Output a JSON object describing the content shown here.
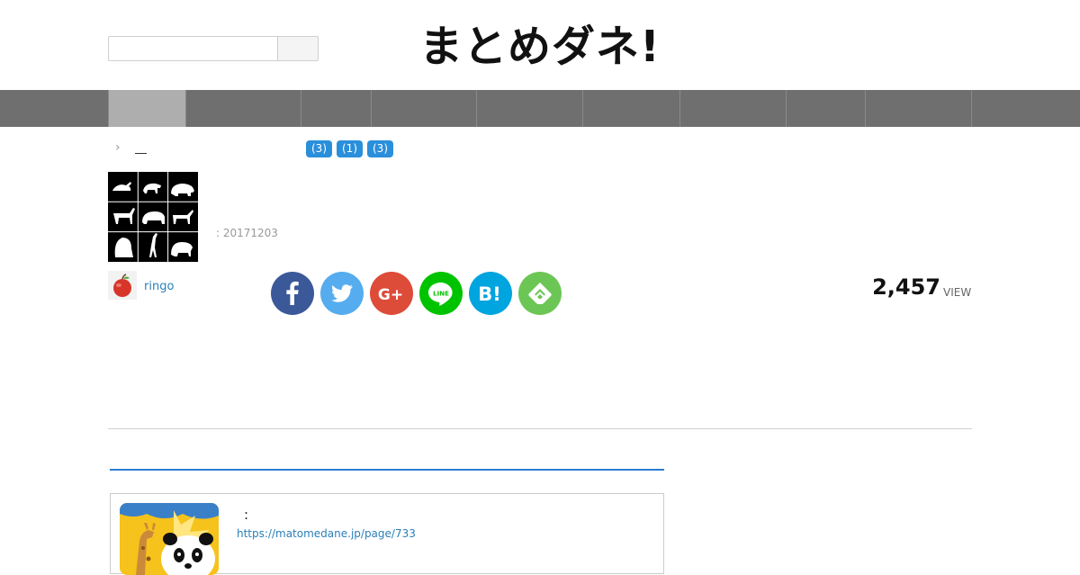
{
  "header": {
    "site_title": "まとめダネ!",
    "search_placeholder": "",
    "search_button_label": ""
  },
  "nav": {
    "items": [
      {
        "label": ""
      },
      {
        "label": ""
      },
      {
        "label": ""
      },
      {
        "label": ""
      },
      {
        "label": ""
      },
      {
        "label": ""
      },
      {
        "label": ""
      },
      {
        "label": ""
      },
      {
        "label": ""
      },
      {
        "label": ""
      }
    ]
  },
  "breadcrumb": {
    "chevron": "›"
  },
  "tags": [
    {
      "label": "(3)"
    },
    {
      "label": "(1)"
    },
    {
      "label": "(3)"
    }
  ],
  "article": {
    "date": ": 20171203",
    "author": "ringo",
    "view_count": "2,457",
    "view_label": "VIEW"
  },
  "share": [
    {
      "name": "facebook",
      "color": "#3b5998",
      "icon": "facebook-icon"
    },
    {
      "name": "twitter",
      "color": "#55acee",
      "icon": "twitter-icon"
    },
    {
      "name": "google-plus",
      "color": "#dd4b39",
      "icon": "google-plus-icon"
    },
    {
      "name": "line",
      "color": "#00c300",
      "icon": "line-icon"
    },
    {
      "name": "hatena",
      "color": "#00a4de",
      "icon": "hatena-bookmark-icon"
    },
    {
      "name": "feedly",
      "color": "#6cc655",
      "icon": "feedly-icon"
    }
  ],
  "related": {
    "title": ":",
    "url": "https://matomedane.jp/page/733"
  },
  "colors": {
    "nav_bg": "#6f6f6f",
    "nav_active": "#aeaeae",
    "tag_bg": "#2a8fdb",
    "link": "#2a7fb8",
    "section_line": "#2a7fd4"
  }
}
